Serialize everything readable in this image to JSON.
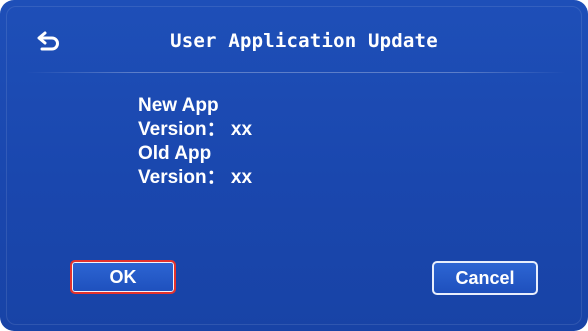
{
  "dialog": {
    "title": "User Application Update",
    "back_icon": "back-arrow-icon",
    "lines": [
      "New App",
      "Version： xx",
      "Old App",
      "Version： xx"
    ],
    "ok_label": "OK",
    "cancel_label": "Cancel",
    "focused_button": "ok"
  },
  "colors": {
    "background": "#1a47ae",
    "text": "#ffffff",
    "focus_border": "#e3322d",
    "button_border": "#e8eefc"
  }
}
